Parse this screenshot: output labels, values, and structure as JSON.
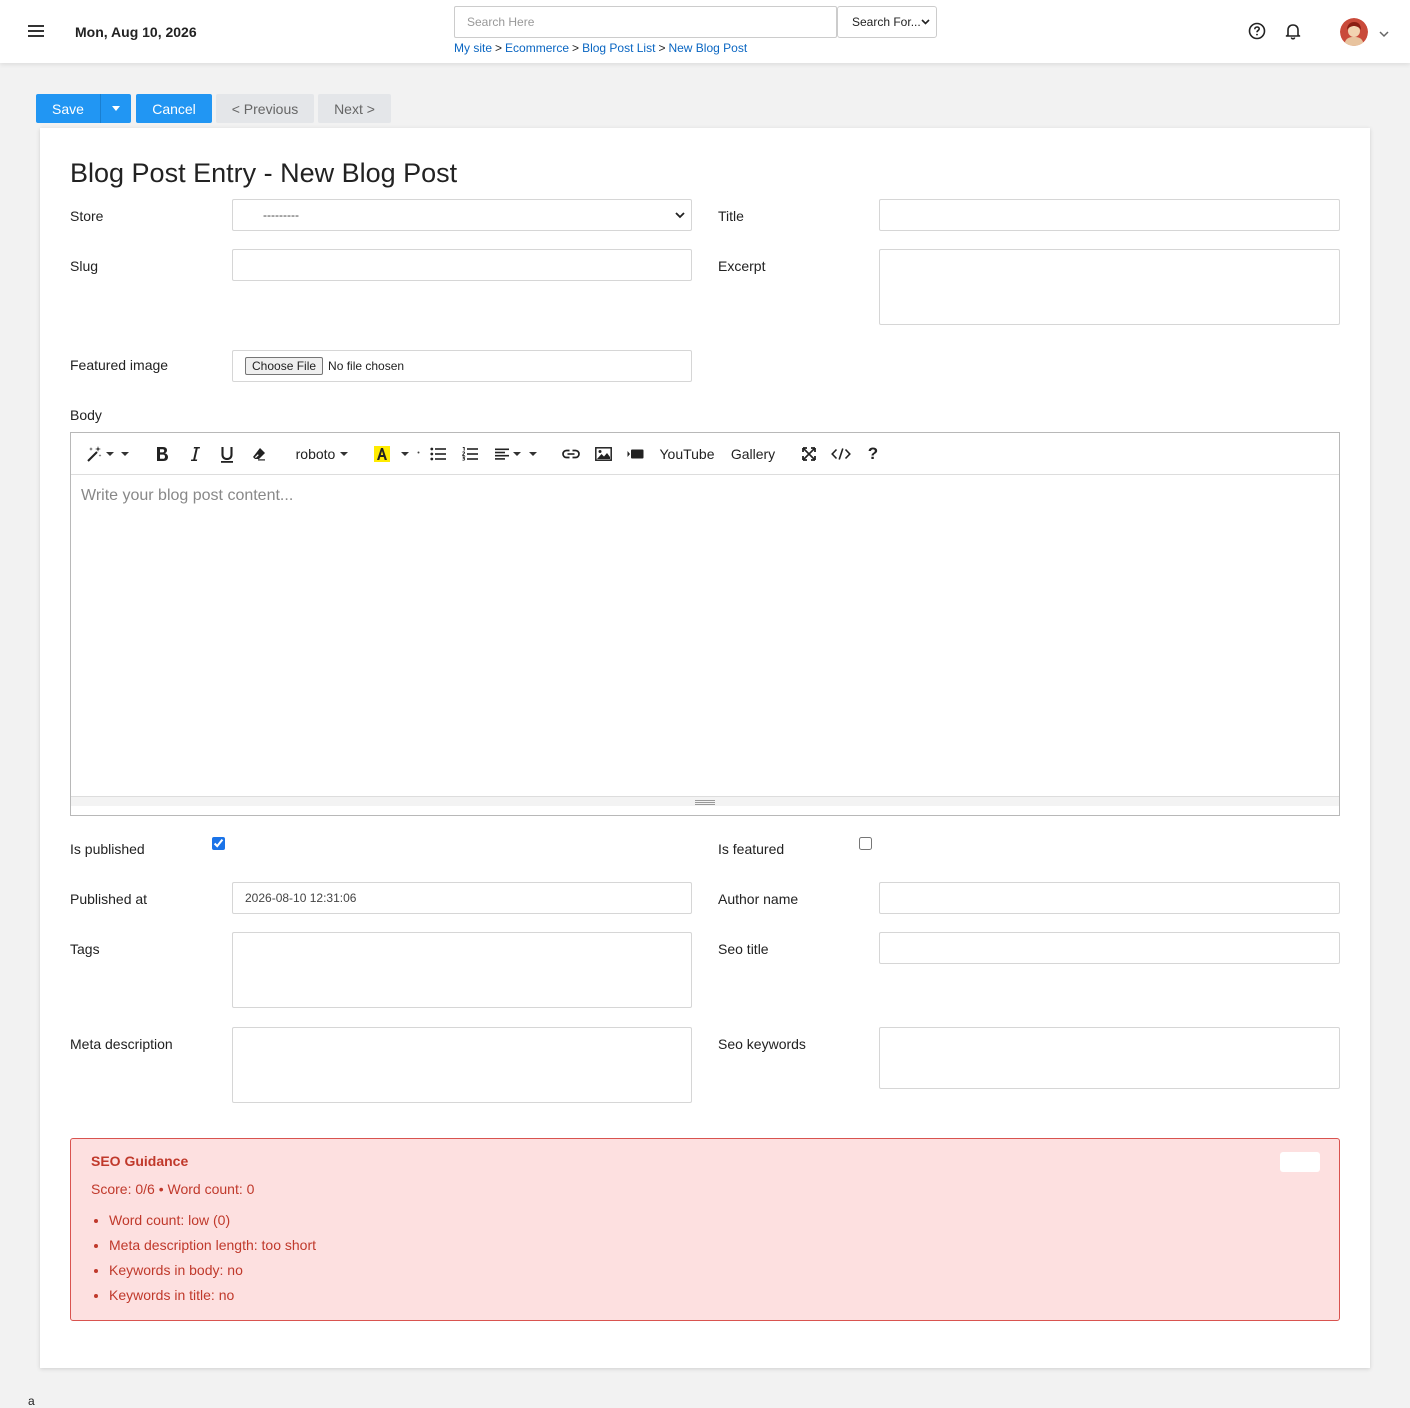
{
  "header": {
    "date": "Mon, Aug 10, 2026",
    "search": {
      "placeholder": "Search Here",
      "value": ""
    },
    "search_for": "Search For...",
    "breadcrumb": [
      "My site",
      "Ecommerce",
      "Blog Post List",
      "New Blog Post"
    ],
    "breadcrumb_sep": ">"
  },
  "actions": {
    "save": "Save",
    "cancel": "Cancel",
    "previous": "< Previous",
    "next": "Next >"
  },
  "colors": {
    "primary": "#2196f3",
    "seo_bg": "#fde0e0",
    "seo_text": "#c0392b"
  },
  "form": {
    "title": "Blog Post Entry - New Blog Post",
    "store": {
      "label": "Store",
      "value": "---------"
    },
    "title_field": {
      "label": "Title",
      "value": ""
    },
    "slug": {
      "label": "Slug",
      "value": ""
    },
    "excerpt": {
      "label": "Excerpt",
      "value": ""
    },
    "featured_image": {
      "label": "Featured image",
      "button": "Choose File",
      "status": "No file chosen"
    },
    "body": {
      "label": "Body",
      "placeholder": "Write your blog post content..."
    },
    "is_published": {
      "label": "Is published",
      "checked": true
    },
    "is_featured": {
      "label": "Is featured",
      "checked": false
    },
    "published_at": {
      "label": "Published at",
      "value": "2026-08-10 12:31:06"
    },
    "author_name": {
      "label": "Author name",
      "value": ""
    },
    "tags": {
      "label": "Tags",
      "value": ""
    },
    "seo_title": {
      "label": "Seo title",
      "value": ""
    },
    "meta_description": {
      "label": "Meta description",
      "value": ""
    },
    "seo_keywords": {
      "label": "Seo keywords",
      "value": ""
    }
  },
  "editor_toolbar": {
    "font": "roboto",
    "youtube": "YouTube",
    "gallery": "Gallery",
    "help": "?"
  },
  "seo": {
    "title": "SEO Guidance",
    "score": "Score: 0/6 • Word count: 0",
    "items": [
      "Word count: low (0)",
      "Meta description length: too short",
      "Keywords in body: no",
      "Keywords in title: no"
    ]
  },
  "footer_char": "a"
}
